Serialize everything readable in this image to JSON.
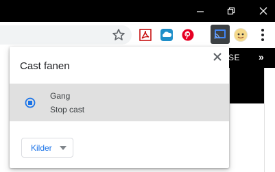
{
  "colors": {
    "titlebar": "#000000",
    "accent_blue": "#1a73e8",
    "cast_button_bg": "#3c4043",
    "sink_highlight": "#e0e0e0"
  },
  "window_controls": {
    "icons": [
      "minimize-icon",
      "restore-icon",
      "close-icon"
    ]
  },
  "toolbar": {
    "extensions": [
      "acrobat-pdf-icon",
      "cloud-extension-icon",
      "pinterest-icon",
      "cast-icon",
      "profile-avatar-icon"
    ],
    "menu_icon": "kebab-menu-icon"
  },
  "bookmarks": {
    "partial_label": "SE",
    "overflow": "»"
  },
  "cast_dialog": {
    "title": "Cast fanen",
    "sink": {
      "name": "Gang",
      "status": "Stop cast",
      "icon": "stop-cast-icon"
    },
    "sources_button": "Kilder"
  }
}
